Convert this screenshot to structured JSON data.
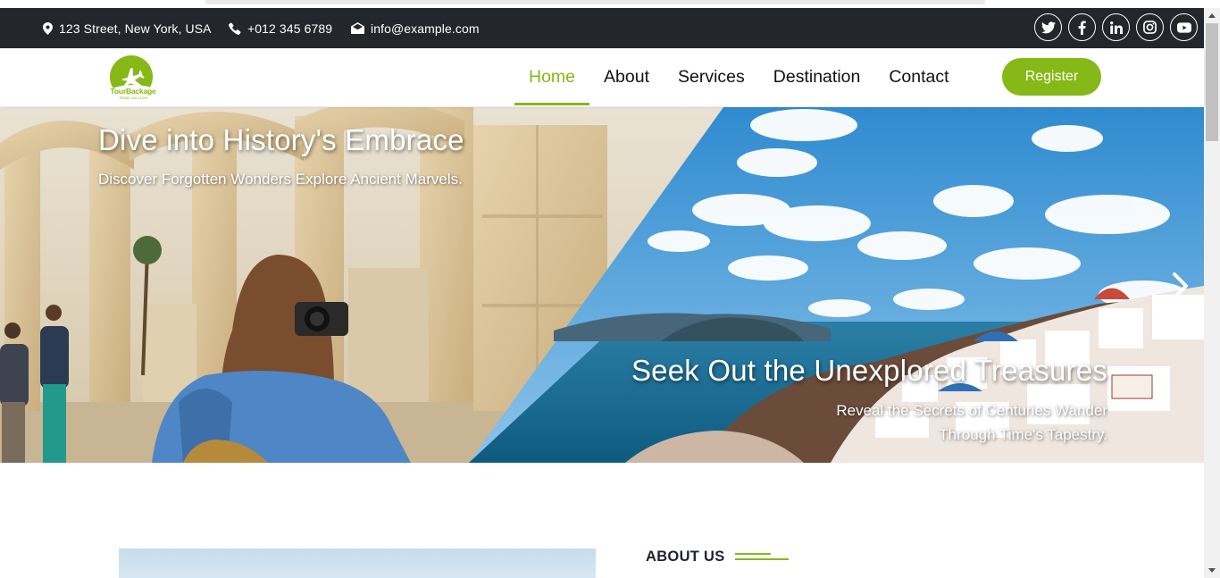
{
  "topbar": {
    "address": "123 Street, New York, USA",
    "phone": "+012 345 6789",
    "email": "info@example.com",
    "socials": [
      "twitter-icon",
      "facebook-icon",
      "linkedin-icon",
      "instagram-icon",
      "youtube-icon"
    ]
  },
  "navbar": {
    "logo_text": "TourBackage",
    "logo_subtext": "TRAVEL SOLUTION",
    "links": [
      "Home",
      "About",
      "Services",
      "Destination",
      "Contact"
    ],
    "active_link": "Home",
    "register_label": "Register"
  },
  "hero": {
    "title_left": "Dive into History's Embrace",
    "subtitle_left": "Discover Forgotten Wonders Explore Ancient Marvels.",
    "title_right": "Seek Out the Unexplored Treasures",
    "subtitle_right": "Reveal the Secrets of Centuries Wander Through Time's Tapestry.",
    "next_icon": "chevron-right-icon"
  },
  "about": {
    "label": "ABOUT US"
  },
  "colors": {
    "accent": "#86b817",
    "topbar_bg": "#23262a",
    "text_dark": "#111111"
  }
}
